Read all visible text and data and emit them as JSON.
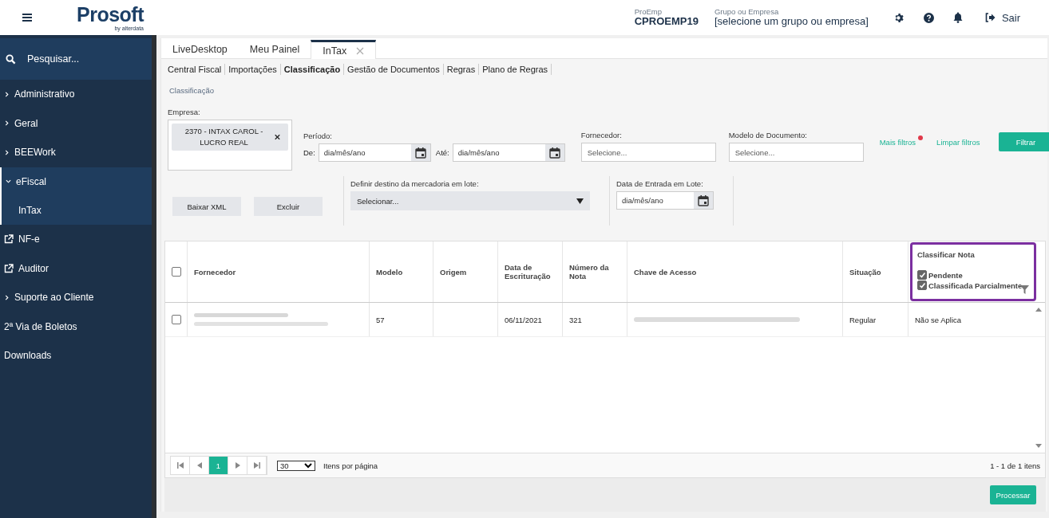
{
  "header": {
    "logo": "Prosoft",
    "logo_tagline": "by alterdata",
    "proemp_label": "ProEmp",
    "proemp_value": "CPROEMP19",
    "group_label": "Grupo ou Empresa",
    "group_value": "[selecione um grupo ou empresa]",
    "logout": "Sair"
  },
  "sidebar": {
    "search_placeholder": "Pesquisar...",
    "items": [
      {
        "label": "Administrativo",
        "kind": "group",
        "expanded": false
      },
      {
        "label": "Geral",
        "kind": "group",
        "expanded": false
      },
      {
        "label": "BEEWork",
        "kind": "group",
        "expanded": false
      },
      {
        "label": "eFiscal",
        "kind": "group",
        "expanded": true,
        "children": [
          {
            "label": "InTax"
          }
        ]
      },
      {
        "label": "NF-e",
        "kind": "link"
      },
      {
        "label": "Auditor",
        "kind": "link"
      },
      {
        "label": "Suporte ao Cliente",
        "kind": "group",
        "expanded": false
      },
      {
        "label": "2ª Via de Boletos",
        "kind": "plain"
      },
      {
        "label": "Downloads",
        "kind": "plain"
      }
    ]
  },
  "tabs": [
    {
      "label": "LiveDesktop",
      "selected": false,
      "closable": false
    },
    {
      "label": "Meu Painel",
      "selected": false,
      "closable": false
    },
    {
      "label": "InTax",
      "selected": true,
      "closable": true
    }
  ],
  "subtabs": [
    {
      "label": "Central Fiscal",
      "selected": false
    },
    {
      "label": "Importações",
      "selected": false
    },
    {
      "label": "Classificação",
      "selected": true
    },
    {
      "label": "Gestão de Documentos",
      "selected": false
    },
    {
      "label": "Regras",
      "selected": false
    },
    {
      "label": "Plano de Regras",
      "selected": false
    }
  ],
  "breadcrumb": "Classificação",
  "filters": {
    "empresa_label": "Empresa:",
    "empresa_chip": "2370 - INTAX CAROL - LUCRO REAL",
    "periodo_label": "Período:",
    "de_label": "De:",
    "de_placeholder": "dia/mês/ano",
    "ate_label": "Até:",
    "ate_placeholder": "dia/mês/ano",
    "fornecedor_label": "Fornecedor:",
    "fornecedor_placeholder": "Selecione...",
    "modelo_label": "Modelo de Documento:",
    "modelo_placeholder": "Selecione...",
    "mais_filtros": "Mais filtros",
    "mais_filtros_active": true,
    "limpar_filtros": "Limpar filtros",
    "filtrar": "Filtrar"
  },
  "batch": {
    "baixar_xml": "Baixar XML",
    "excluir": "Excluir",
    "destino_label": "Definir destino da mercadoria em lote:",
    "destino_value": "Selecionar...",
    "data_label": "Data de Entrada em Lote:",
    "data_placeholder": "dia/mês/ano"
  },
  "table": {
    "all_checked": false,
    "columns": [
      "Fornecedor",
      "Modelo",
      "Origem",
      "Data de Escrituração",
      "Número da Nota",
      "Chave de Acesso",
      "Situação"
    ],
    "classificar": {
      "title": "Classificar Nota",
      "options": [
        {
          "label": "Pendente",
          "checked": true
        },
        {
          "label": "Classificada Parcialmente",
          "checked": true
        }
      ]
    },
    "rows": [
      {
        "checked": false,
        "fornecedor_blurred": true,
        "modelo": "57",
        "origem": "",
        "data": "06/11/2021",
        "numero": "321",
        "chave_blurred": true,
        "situacao": "Regular",
        "classificar": "Não se Aplica"
      }
    ]
  },
  "pager": {
    "page": "1",
    "page_size": "30",
    "per_page_label": "Itens por página",
    "summary": "1 - 1 de 1 itens"
  },
  "processar": "Processar"
}
